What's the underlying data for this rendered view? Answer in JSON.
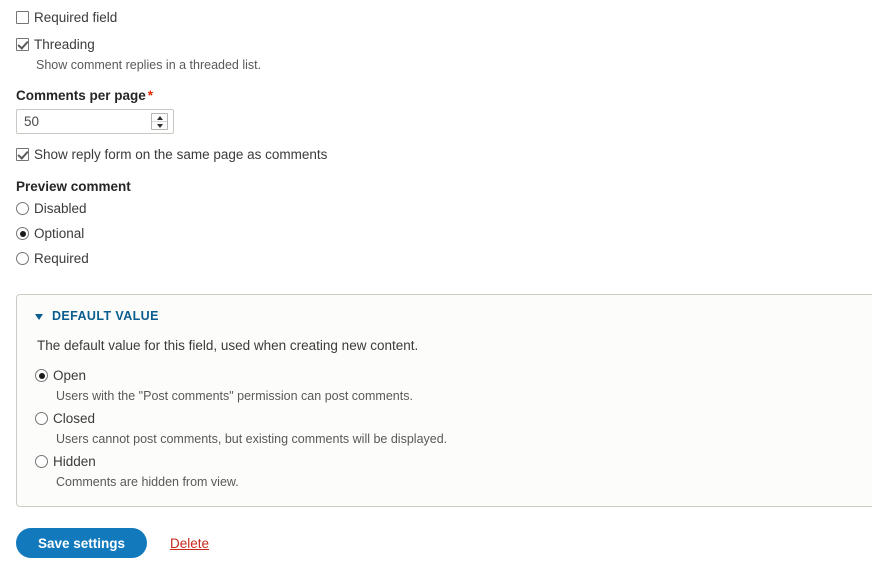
{
  "form": {
    "required_field": {
      "label": "Required field",
      "checked": false
    },
    "threading": {
      "label": "Threading",
      "description": "Show comment replies in a threaded list.",
      "checked": true
    },
    "comments_per_page": {
      "label": "Comments per page",
      "required_marker": "*",
      "value": "50"
    },
    "show_reply_form": {
      "label": "Show reply form on the same page as comments",
      "checked": true
    },
    "preview_comment": {
      "label": "Preview comment",
      "options": [
        {
          "label": "Disabled",
          "selected": false
        },
        {
          "label": "Optional",
          "selected": true
        },
        {
          "label": "Required",
          "selected": false
        }
      ]
    }
  },
  "default_value_fieldset": {
    "legend": "DEFAULT VALUE",
    "description": "The default value for this field, used when creating new content.",
    "options": [
      {
        "label": "Open",
        "description": "Users with the \"Post comments\" permission can post comments.",
        "selected": true
      },
      {
        "label": "Closed",
        "description": "Users cannot post comments, but existing comments will be displayed.",
        "selected": false
      },
      {
        "label": "Hidden",
        "description": "Comments are hidden from view.",
        "selected": false
      }
    ]
  },
  "actions": {
    "save_label": "Save settings",
    "delete_label": "Delete"
  },
  "colors": {
    "primary_button": "#1279bd",
    "legend_blue": "#0a5d8f",
    "delete_red": "#c7291c",
    "required_star_red": "#e42800",
    "fieldset_bg": "#fcfcfa",
    "fieldset_border": "#ccccc6"
  }
}
